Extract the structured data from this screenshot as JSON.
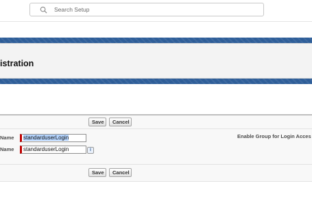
{
  "header": {
    "search_placeholder": "Search Setup",
    "search_icon": "search-icon"
  },
  "page": {
    "title": "istration"
  },
  "form": {
    "top_save": "Save",
    "top_cancel": "Cancel",
    "bottom_save": "Save",
    "bottom_cancel": "Cancel",
    "label_name_1": "Name",
    "label_name_2": "Name",
    "field_1_value": "standarduserLogin",
    "field_2_value": "standarduserLogin",
    "info_icon": "i",
    "enable_group_label": "Enable Group for Login Acces"
  },
  "colors": {
    "accent_band": "#2f5f9a",
    "required_marker": "#c00000",
    "selection": "#b5d5ff"
  }
}
